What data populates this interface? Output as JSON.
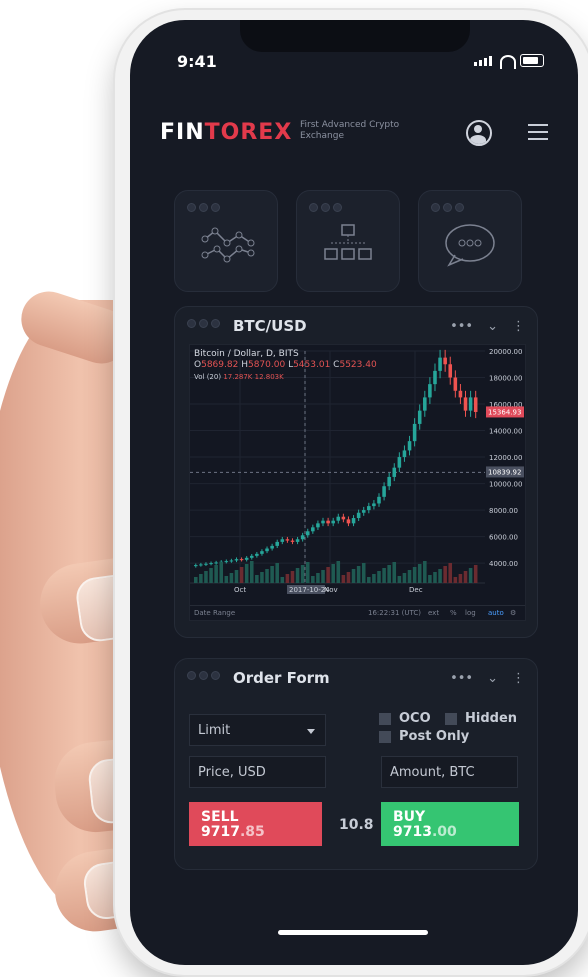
{
  "status": {
    "time": "9:41"
  },
  "brand": {
    "logo_prefix": "FIN",
    "logo_accent": "TOREX",
    "tagline": "First Advanced Crypto Exchange"
  },
  "chart_card": {
    "title": "BTC/USD",
    "instrument": "Bitcoin / Dollar, D, BITS",
    "ohlc": {
      "o_label": "O",
      "o": "5869.82",
      "h_label": "H",
      "h": "5870.00",
      "l_label": "L",
      "l": "5453.01",
      "c_label": "C",
      "c": "5523.40"
    },
    "vol_label": "Vol (20)",
    "vol_values": [
      "17.287K",
      "12.803K"
    ],
    "y_ticks": [
      "20000.00",
      "18000.00",
      "16000.00",
      "14000.00",
      "12000.00",
      "10000.00",
      "8000.00",
      "6000.00",
      "4000.00"
    ],
    "current_price": "15364.93",
    "crosshair_price": "10839.92",
    "x_labels": [
      "Oct",
      "2017-10-24",
      "Nov",
      "Dec"
    ],
    "bottom_bar": {
      "range": "Date Range",
      "time": "16:22:31 (UTC)",
      "ext": "ext",
      "pct": "%",
      "log": "log",
      "auto": "auto"
    }
  },
  "order_form": {
    "title": "Order Form",
    "order_type": "Limit",
    "oco": "OCO",
    "hidden": "Hidden",
    "post_only": "Post Only",
    "price_placeholder": "Price, USD",
    "amount_placeholder": "Amount, BTC",
    "sell_label": "SELL",
    "sell_price_main": "9717",
    "sell_price_dim": ".85",
    "spread": "10.8",
    "buy_label": "BUY",
    "buy_price_main": "9713",
    "buy_price_dim": ".00"
  },
  "colors": {
    "accent_red": "#e04a5a",
    "accent_green": "#35c572",
    "background": "#161a24"
  },
  "icons": [
    "signal-bars-icon",
    "wifi-icon",
    "battery-icon",
    "avatar-icon",
    "menu-icon",
    "analytics-icon",
    "hierarchy-icon",
    "chat-icon"
  ],
  "chart_data": {
    "type": "candlestick",
    "title": "Bitcoin / Dollar, D, BITS",
    "x_labels": [
      "Oct",
      "Nov",
      "Dec"
    ],
    "y_ticks": [
      20000,
      18000,
      16000,
      14000,
      12000,
      10000,
      8000,
      6000,
      4000
    ],
    "ylim": [
      2500,
      20000
    ],
    "series": [
      {
        "name": "BTC/USD",
        "close": [
          3850,
          3900,
          3950,
          4000,
          4050,
          4100,
          4150,
          4200,
          4300,
          4250,
          4400,
          4550,
          4700,
          4900,
          5100,
          5300,
          5600,
          5800,
          5700,
          5600,
          5800,
          6100,
          6400,
          6700,
          7000,
          7200,
          7000,
          7200,
          7500,
          7300,
          7000,
          7400,
          7800,
          8000,
          8300,
          8500,
          9000,
          9800,
          10500,
          11200,
          12000,
          12500,
          13200,
          14500,
          15500,
          16500,
          17500,
          18500,
          19500,
          19000,
          18000,
          17000,
          16500,
          15500,
          16500,
          15400
        ]
      }
    ]
  }
}
